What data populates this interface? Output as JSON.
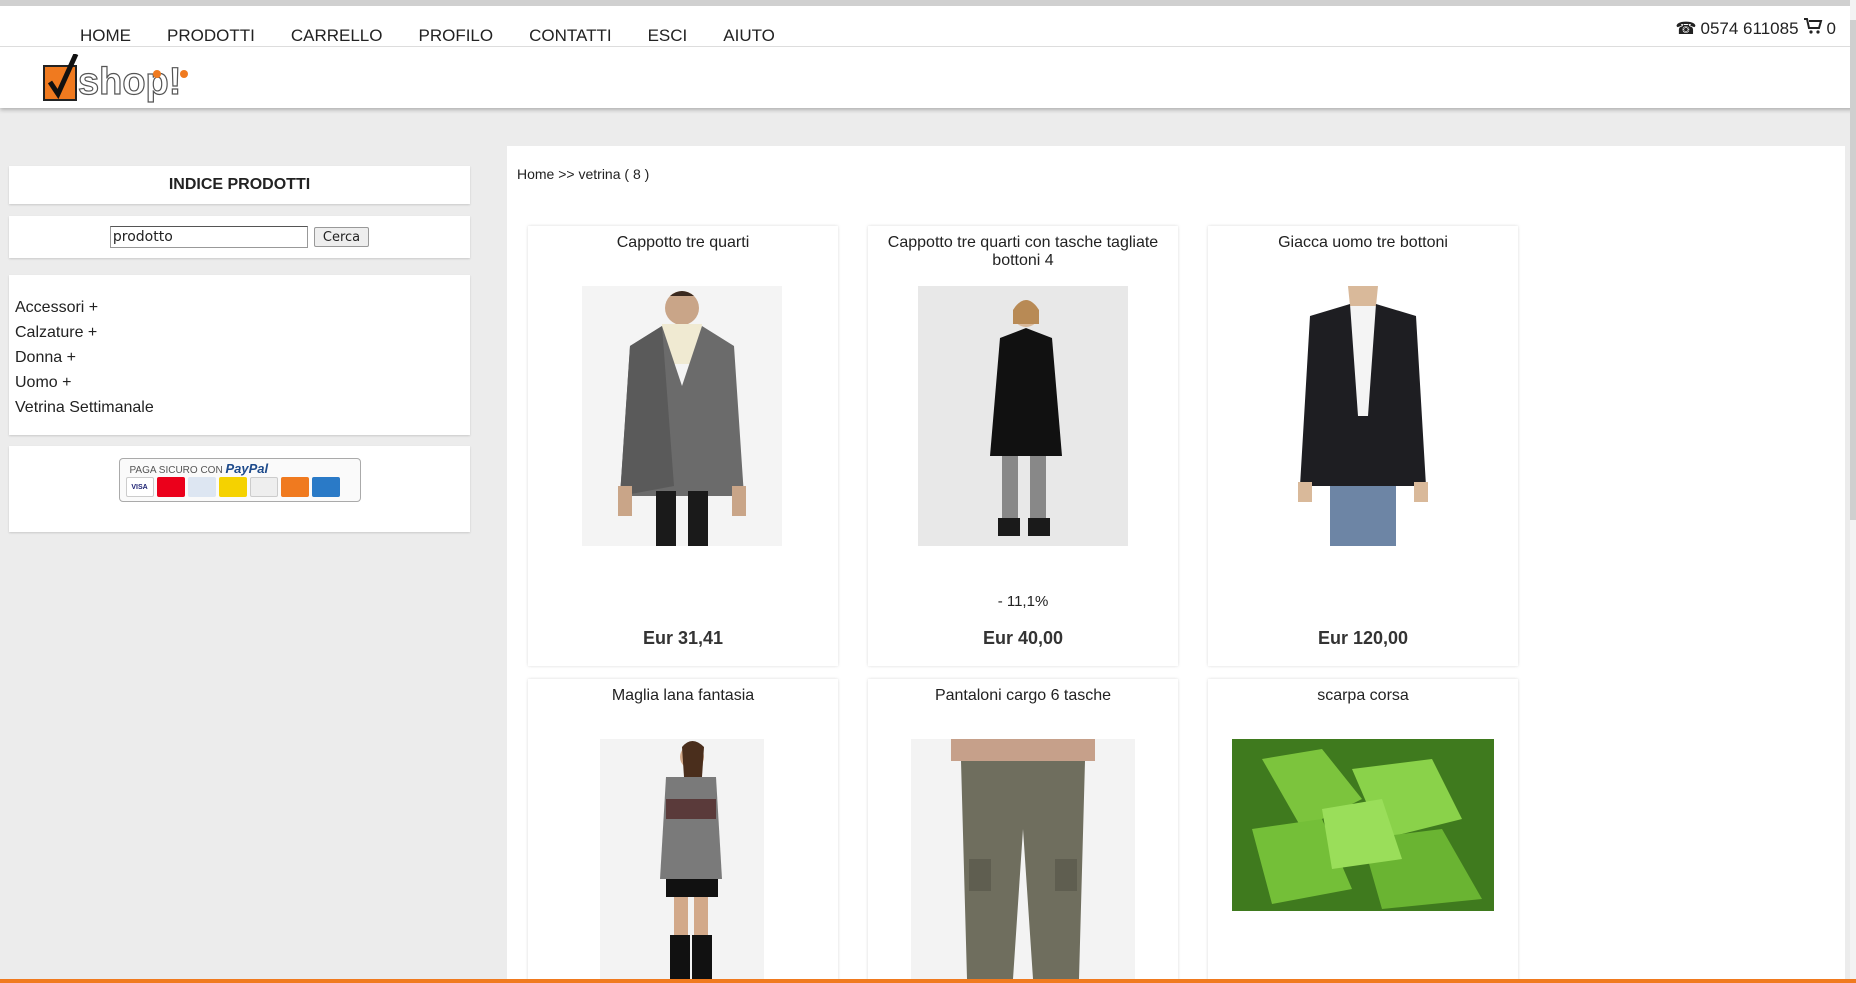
{
  "nav": {
    "items": [
      "HOME",
      "PRODOTTI",
      "CARRELLO",
      "PROFILO",
      "CONTATTI",
      "ESCI",
      "AIUTO"
    ],
    "phone": "0574 611085",
    "cart_count": "0"
  },
  "logo": {
    "text": "shop!"
  },
  "sidebar": {
    "title": "INDICE PRODOTTI",
    "search": {
      "value": "prodotto",
      "button": "Cerca"
    },
    "categories": [
      "Accessori +",
      "Calzature +",
      "Donna +",
      "Uomo +",
      "Vetrina Settimanale"
    ],
    "paypal": {
      "caption": "PAGA SICURO CON",
      "brand": "PayPal"
    }
  },
  "breadcrumb": "Home >> vetrina ( 8 )",
  "products": [
    {
      "name": "Cappotto tre quarti",
      "discount": "",
      "price": "Eur 31,41"
    },
    {
      "name": "Cappotto tre quarti con tasche tagliate bottoni 4",
      "discount": "- 11,1%",
      "price": "Eur 40,00"
    },
    {
      "name": "Giacca uomo tre bottoni",
      "discount": "",
      "price": "Eur 120,00"
    },
    {
      "name": "Maglia lana fantasia",
      "discount": "",
      "price": ""
    },
    {
      "name": "Pantaloni cargo 6 tasche",
      "discount": "",
      "price": ""
    },
    {
      "name": "scarpa corsa",
      "discount": "",
      "price": ""
    }
  ],
  "colors": {
    "accent": "#f07a1f",
    "paypal_blue": "#1e4b8c"
  }
}
